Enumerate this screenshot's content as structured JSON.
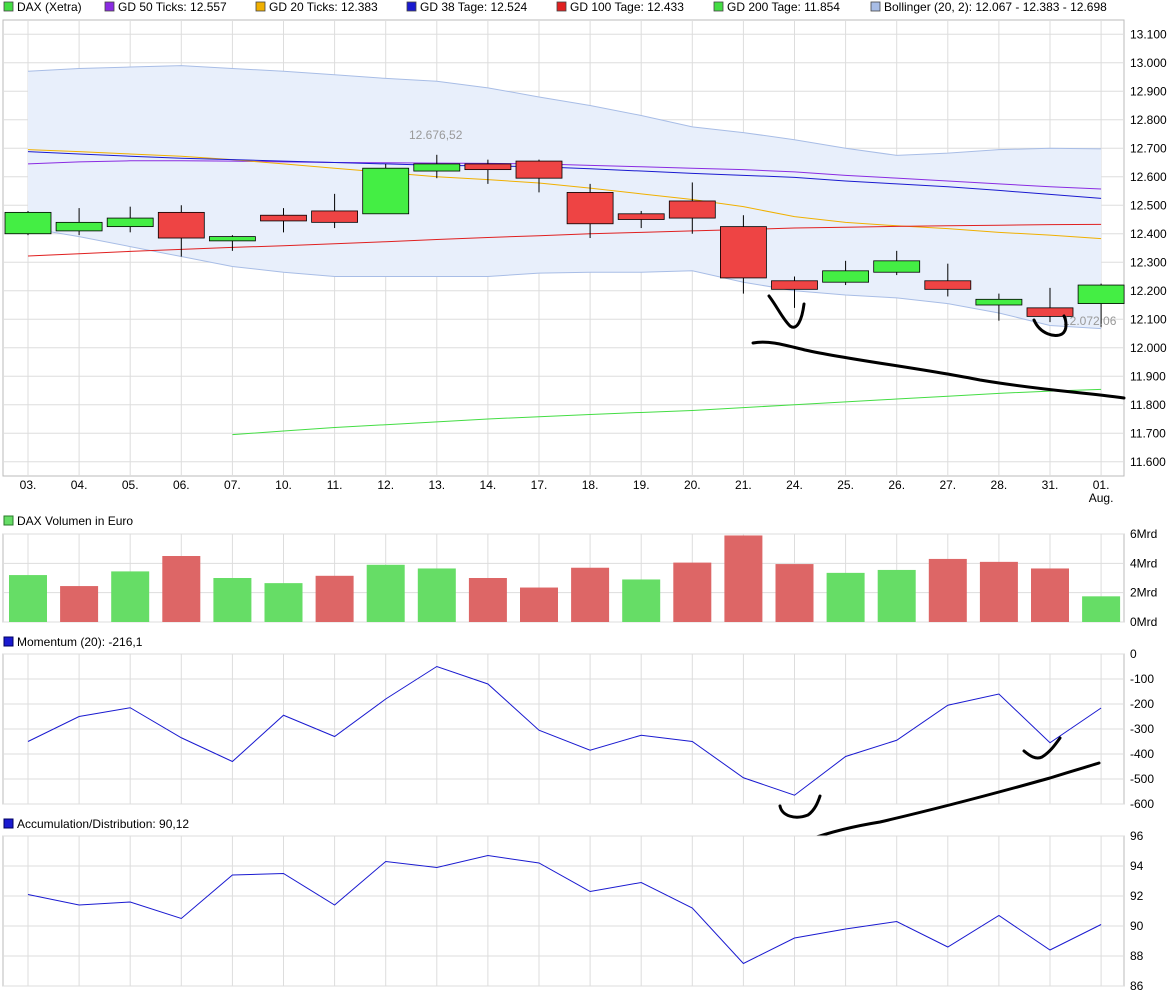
{
  "legend": [
    {
      "label": "DAX (Xetra)",
      "color": "#44dd44"
    },
    {
      "label": "GD 50 Ticks: 12.557",
      "color": "#8a2be2"
    },
    {
      "label": "GD 20 Ticks: 12.383",
      "color": "#f0b000"
    },
    {
      "label": "GD 38 Tage: 12.524",
      "color": "#1a1ad0"
    },
    {
      "label": "GD 100 Tage: 12.433",
      "color": "#e02020"
    },
    {
      "label": "GD 200 Tage: 11.854",
      "color": "#44dd44"
    },
    {
      "label": "Bollinger (20, 2): 12.067 - 12.383 - 12.698",
      "color": "#a8bde6"
    }
  ],
  "panel_titles": {
    "volume": "DAX Volumen in Euro",
    "momentum": "Momentum (20): -216,1",
    "ad": "Accumulation/Distribution: 90,12"
  },
  "annotations": {
    "high": "12.676,52",
    "low": "12.072,06"
  },
  "x_labels": [
    "03.",
    "04.",
    "05.",
    "06.",
    "07.",
    "10.",
    "11.",
    "12.",
    "13.",
    "14.",
    "17.",
    "18.",
    "19.",
    "20.",
    "21.",
    "24.",
    "25.",
    "26.",
    "27.",
    "28.",
    "31.",
    "01."
  ],
  "x_sublabel": "Aug.",
  "colors": {
    "up": "#44ee44",
    "down": "#ee4444",
    "vol_up": "#66dd66",
    "vol_down": "#dd6666",
    "line": "#1a1ad0",
    "bb_fill": "#e8effb",
    "bb_line": "#a8bde6",
    "grid": "#dddddd",
    "ink": "#000000"
  },
  "chart_data": [
    {
      "type": "candlestick",
      "ylim": [
        11550,
        13150
      ],
      "y_ticks": [
        11600,
        11700,
        11800,
        11900,
        12000,
        12100,
        12200,
        12300,
        12400,
        12500,
        12600,
        12700,
        12800,
        12900,
        13000,
        13100
      ],
      "y_tick_labels": [
        "11.600",
        "11.700",
        "11.800",
        "11.900",
        "12.000",
        "12.100",
        "12.200",
        "12.300",
        "12.400",
        "12.500",
        "12.600",
        "12.700",
        "12.800",
        "12.900",
        "13.000",
        "13.100"
      ],
      "candles": [
        {
          "o": 12400,
          "h": 12480,
          "l": 12395,
          "c": 12475
        },
        {
          "o": 12410,
          "h": 12490,
          "l": 12395,
          "c": 12440
        },
        {
          "o": 12425,
          "h": 12495,
          "l": 12405,
          "c": 12455
        },
        {
          "o": 12475,
          "h": 12500,
          "l": 12320,
          "c": 12385
        },
        {
          "o": 12375,
          "h": 12395,
          "l": 12340,
          "c": 12390
        },
        {
          "o": 12465,
          "h": 12490,
          "l": 12405,
          "c": 12445
        },
        {
          "o": 12480,
          "h": 12540,
          "l": 12420,
          "c": 12440
        },
        {
          "o": 12470,
          "h": 12645,
          "l": 12470,
          "c": 12630
        },
        {
          "o": 12620,
          "h": 12677,
          "l": 12595,
          "c": 12645
        },
        {
          "o": 12645,
          "h": 12660,
          "l": 12575,
          "c": 12625
        },
        {
          "o": 12655,
          "h": 12660,
          "l": 12545,
          "c": 12595
        },
        {
          "o": 12545,
          "h": 12575,
          "l": 12385,
          "c": 12435
        },
        {
          "o": 12470,
          "h": 12480,
          "l": 12420,
          "c": 12450
        },
        {
          "o": 12515,
          "h": 12580,
          "l": 12400,
          "c": 12455
        },
        {
          "o": 12425,
          "h": 12465,
          "l": 12190,
          "c": 12245
        },
        {
          "o": 12235,
          "h": 12250,
          "l": 12140,
          "c": 12205
        },
        {
          "o": 12230,
          "h": 12305,
          "l": 12220,
          "c": 12270
        },
        {
          "o": 12265,
          "h": 12340,
          "l": 12255,
          "c": 12305
        },
        {
          "o": 12235,
          "h": 12295,
          "l": 12180,
          "c": 12205
        },
        {
          "o": 12150,
          "h": 12190,
          "l": 12095,
          "c": 12170
        },
        {
          "o": 12140,
          "h": 12210,
          "l": 12090,
          "c": 12110
        },
        {
          "o": 12155,
          "h": 12225,
          "l": 12072,
          "c": 12220
        }
      ],
      "series": [
        {
          "name": "GD 50 Ticks",
          "color": "#8a2be2",
          "values": [
            12645,
            12652,
            12656,
            12656,
            12655,
            12652,
            12650,
            12649,
            12648,
            12647,
            12645,
            12640,
            12635,
            12630,
            12625,
            12617,
            12605,
            12595,
            12585,
            12575,
            12565,
            12557
          ]
        },
        {
          "name": "GD 20 Ticks",
          "color": "#f0b000",
          "values": [
            12695,
            12688,
            12680,
            12672,
            12660,
            12645,
            12630,
            12615,
            12600,
            12590,
            12578,
            12560,
            12540,
            12520,
            12495,
            12460,
            12440,
            12428,
            12418,
            12405,
            12395,
            12383
          ]
        },
        {
          "name": "GD 38 Tage",
          "color": "#1a1ad0",
          "values": [
            12688,
            12680,
            12672,
            12665,
            12660,
            12655,
            12650,
            12645,
            12640,
            12638,
            12635,
            12628,
            12620,
            12612,
            12605,
            12598,
            12585,
            12575,
            12565,
            12552,
            12538,
            12524
          ]
        },
        {
          "name": "GD 100 Tage",
          "color": "#e02020",
          "values": [
            12322,
            12330,
            12338,
            12345,
            12352,
            12358,
            12365,
            12372,
            12380,
            12387,
            12393,
            12400,
            12405,
            12410,
            12415,
            12420,
            12423,
            12426,
            12428,
            12430,
            12432,
            12433
          ]
        },
        {
          "name": "GD 200 Tage",
          "color": "#44dd44",
          "start_index": 4,
          "values": [
            null,
            null,
            null,
            null,
            11695,
            11708,
            11720,
            11730,
            11740,
            11750,
            11758,
            11766,
            11773,
            11780,
            11790,
            11800,
            11810,
            11820,
            11830,
            11840,
            11848,
            11854
          ]
        }
      ],
      "bollinger": {
        "upper": [
          12970,
          12980,
          12985,
          12990,
          12980,
          12970,
          12958,
          12945,
          12935,
          12912,
          12880,
          12850,
          12815,
          12775,
          12755,
          12730,
          12700,
          12675,
          12683,
          12695,
          12700,
          12698
        ],
        "lower": [
          12420,
          12390,
          12355,
          12320,
          12285,
          12265,
          12250,
          12250,
          12250,
          12250,
          12262,
          12265,
          12265,
          12270,
          12230,
          12200,
          12185,
          12175,
          12155,
          12122,
          12078,
          12067
        ]
      }
    },
    {
      "type": "bar",
      "title": "DAX Volumen in Euro",
      "ylim": [
        0,
        6
      ],
      "y_ticks": [
        0,
        2,
        4,
        6
      ],
      "y_tick_labels": [
        "0Mrd",
        "2Mrd",
        "4Mrd",
        "6Mrd"
      ],
      "values": [
        3.2,
        2.45,
        3.45,
        4.5,
        3.0,
        2.65,
        3.15,
        3.9,
        3.65,
        3.0,
        2.35,
        3.7,
        2.9,
        4.05,
        5.9,
        3.95,
        3.35,
        3.55,
        4.3,
        4.1,
        3.65,
        1.75
      ],
      "colors": [
        "up",
        "down",
        "up",
        "down",
        "up",
        "up",
        "down",
        "up",
        "up",
        "down",
        "down",
        "down",
        "up",
        "down",
        "down",
        "down",
        "up",
        "up",
        "down",
        "down",
        "down",
        "up"
      ]
    },
    {
      "type": "line",
      "title": "Momentum (20): -216,1",
      "ylim": [
        -600,
        0
      ],
      "y_ticks": [
        -600,
        -500,
        -400,
        -300,
        -200,
        -100,
        0
      ],
      "y_tick_labels": [
        "-600",
        "-500",
        "-400",
        "-300",
        "-200",
        "-100",
        "0"
      ],
      "values": [
        -350,
        -250,
        -215,
        -335,
        -430,
        -245,
        -330,
        -180,
        -50,
        -120,
        -305,
        -385,
        -325,
        -350,
        -495,
        -565,
        -410,
        -345,
        -205,
        -160,
        -355,
        -216
      ]
    },
    {
      "type": "line",
      "title": "Accumulation/Distribution: 90,12",
      "ylim": [
        86,
        96
      ],
      "y_ticks": [
        86,
        88,
        90,
        92,
        94,
        96
      ],
      "y_tick_labels": [
        "86",
        "88",
        "90",
        "92",
        "94",
        "96"
      ],
      "values": [
        92.1,
        91.4,
        91.6,
        90.5,
        93.4,
        93.5,
        91.4,
        94.3,
        93.9,
        94.7,
        94.2,
        92.3,
        92.9,
        91.2,
        87.5,
        89.2,
        89.8,
        90.3,
        88.6,
        90.7,
        88.4,
        90.1
      ]
    }
  ]
}
